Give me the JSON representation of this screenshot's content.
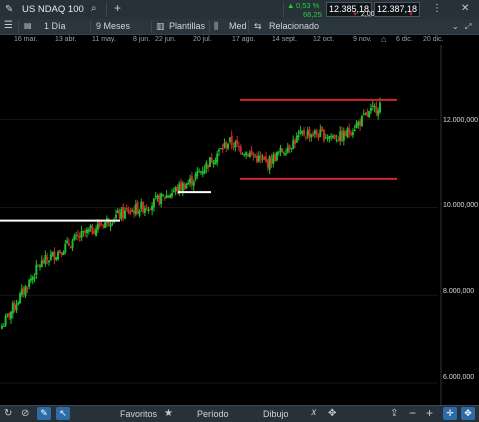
{
  "header": {
    "chart_icon": "pencil-chart-icon",
    "symbol": "US NDAQ 100",
    "search_icon": "search-icon",
    "add_icon": "plus-icon",
    "change_pct": "0,53 %",
    "change_abs": "66,25",
    "bid": "12.385,18",
    "ask": "12.387,18",
    "spread": "2,00",
    "menu_icon": "vertical-dots-icon"
  },
  "toolbar": {
    "interval": "1 Día",
    "range": "9 Meses",
    "templates": "Plantillas",
    "price_type": "Med",
    "related": "Relacionado"
  },
  "dates": [
    "16 mar.",
    "13 abr.",
    "11 may.",
    "8 jun.",
    "22 jun.",
    "20 jul.",
    "17 ago.",
    "14 sept.",
    "12 oct.",
    "9 nov.",
    "6 dic.",
    "20 dic."
  ],
  "yaxis": [
    "12.000,000",
    "10.000,000",
    "8.000,000",
    "6.000,000"
  ],
  "bottom": {
    "favorites": "Favoritos",
    "period": "Período",
    "drawing": "Dibujo"
  },
  "colors": {
    "up": "#1fbf2a",
    "down": "#d0262a",
    "resistance": "#d0262a",
    "support_line": "#ffffff",
    "accent": "#2e6ca8"
  },
  "chart_data": {
    "type": "candlestick",
    "title": "US NDAQ 100",
    "x": [
      "16 mar.",
      "13 abr.",
      "11 may.",
      "8 jun.",
      "22 jun.",
      "20 jul.",
      "17 ago.",
      "14 sept.",
      "12 oct.",
      "9 nov.",
      "6 dic."
    ],
    "close": [
      7300,
      8700,
      9300,
      9800,
      10100,
      10600,
      11500,
      11000,
      11700,
      11600,
      12350
    ],
    "ylim": [
      5500,
      13700
    ],
    "yticks": [
      6000,
      8000,
      10000,
      12000
    ],
    "annotations": [
      {
        "type": "hline",
        "y": 12450,
        "color": "red"
      },
      {
        "type": "hline",
        "y": 10650,
        "color": "red"
      },
      {
        "type": "hline",
        "y": 9700,
        "color": "white"
      },
      {
        "type": "hline",
        "y": 10350,
        "color": "white"
      }
    ]
  }
}
